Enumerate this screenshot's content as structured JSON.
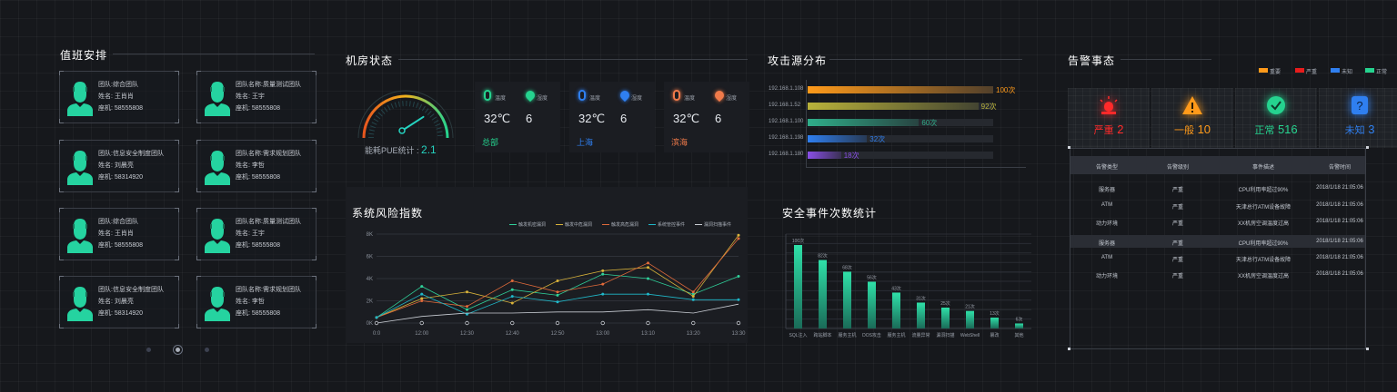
{
  "duty": {
    "title": "值班安排",
    "cards": [
      [
        "团队:综合团队",
        "姓名: 王肖肖",
        "座机: 58555808"
      ],
      [
        "团队名称:质量测试团队",
        "姓名: 王宇",
        "座机: 58555808"
      ],
      [
        "团队:信息安全制度团队",
        "姓名: 刘晨亮",
        "座机: 58314920"
      ],
      [
        "团队名称:需求规划团队",
        "姓名: 李哲",
        "座机: 58555808"
      ],
      [
        "团队:综合团队",
        "姓名: 王肖肖",
        "座机: 58555808"
      ],
      [
        "团队名称:质量测试团队",
        "姓名: 王宇",
        "座机: 58555808"
      ],
      [
        "团队:信息安全制度团队",
        "姓名: 刘晨亮",
        "座机: 58314920"
      ],
      [
        "团队名称:需求规划团队",
        "姓名: 李哲",
        "座机: 58555808"
      ]
    ]
  },
  "room": {
    "title": "机房状态",
    "pue_label": "能耗PUE统计 :",
    "pue_value": "2.1",
    "pue_level": 0.65,
    "sites": [
      {
        "temp_label": "温度",
        "hum_label": "湿度",
        "temp": "32℃",
        "hum": "6",
        "name": "总部",
        "color": "#25d38f"
      },
      {
        "temp_label": "温度",
        "hum_label": "湿度",
        "temp": "32℃",
        "hum": "6",
        "name": "上海",
        "color": "#2f7ff0"
      },
      {
        "temp_label": "温度",
        "hum_label": "湿度",
        "temp": "32℃",
        "hum": "6",
        "name": "滨海",
        "color": "#f07a4a"
      }
    ]
  },
  "attack": {
    "title": "攻击源分布",
    "rows": [
      {
        "ip": "192.168.1.108",
        "value": 100,
        "label": "100次",
        "color": "#ff9a1a"
      },
      {
        "ip": "192.168.1.52",
        "value": 92,
        "label": "92次",
        "color": "#b9b23a"
      },
      {
        "ip": "192.168.1.100",
        "value": 60,
        "label": "60次",
        "color": "#2fae8a"
      },
      {
        "ip": "192.168.1.198",
        "value": 32,
        "label": "32次",
        "color": "#2f7ff0"
      },
      {
        "ip": "192.168.1.180",
        "value": 18,
        "label": "18次",
        "color": "#8a4fe8"
      }
    ]
  },
  "risk": {
    "title": "系统风险指数",
    "chart_data": {
      "type": "line",
      "categories": [
        "0:0",
        "12:00",
        "12:30",
        "12:40",
        "12:50",
        "13:00",
        "13:10",
        "13:20",
        "13:30"
      ],
      "ylim": [
        0,
        8000
      ],
      "yticks": [
        "0K",
        "2K",
        "4K",
        "6K",
        "8K"
      ],
      "series": [
        {
          "name": "触发机密漏洞",
          "color": "#2fd19a",
          "values": [
            500,
            3300,
            1200,
            3000,
            2500,
            4400,
            4000,
            2600,
            4200
          ]
        },
        {
          "name": "触发中危漏洞",
          "color": "#d9b33a",
          "values": [
            500,
            2200,
            2800,
            1800,
            3800,
            4700,
            5000,
            2400,
            7900
          ]
        },
        {
          "name": "触发高危漏洞",
          "color": "#e06a3a",
          "values": [
            500,
            2000,
            1500,
            3800,
            2800,
            3500,
            5400,
            2800,
            7600
          ]
        },
        {
          "name": "系统管控事件",
          "color": "#1fb8c9",
          "values": [
            500,
            2600,
            800,
            2400,
            1900,
            2600,
            2600,
            2100,
            2100
          ]
        },
        {
          "name": "漏洞扫描事件",
          "color": "#c8ccd3",
          "values": [
            0,
            600,
            900,
            900,
            1000,
            1000,
            1200,
            900,
            1700
          ]
        }
      ]
    }
  },
  "events": {
    "title": "安全事件次数统计",
    "chart_data": {
      "type": "bar",
      "categories": [
        "SQL注入",
        "跨站脚本",
        "服务主机",
        "DOS攻击",
        "服务主机",
        "流量异常",
        "漏洞扫描",
        "WebShell",
        "篡改",
        "其他"
      ],
      "values": [
        100,
        82,
        68,
        56,
        43,
        31,
        25,
        21,
        13,
        6
      ],
      "labels": [
        "100次",
        "82次",
        "68次",
        "56次",
        "43次",
        "31次",
        "25次",
        "21次",
        "13次",
        "6次"
      ]
    }
  },
  "alarm": {
    "title": "告警事态",
    "legend": [
      {
        "label": "重要",
        "color": "#ff9a1a"
      },
      {
        "label": "严重",
        "color": "#e81c1c"
      },
      {
        "label": "未知",
        "color": "#2f7ff0"
      },
      {
        "label": "正常",
        "color": "#25d38f"
      }
    ],
    "tiles": [
      {
        "label": "严重",
        "count": "2",
        "color": "#ff2a2a",
        "icon": "siren"
      },
      {
        "label": "一般",
        "count": "10",
        "color": "#ff9a1a",
        "icon": "warning"
      },
      {
        "label": "正常",
        "count": "516",
        "color": "#25d38f",
        "icon": "check"
      },
      {
        "label": "未知",
        "count": "3",
        "color": "#2f7ff0",
        "icon": "question"
      }
    ],
    "table": {
      "headers": [
        "告警类型",
        "告警级别",
        "事件描述",
        "告警时间"
      ],
      "rows": [
        [
          "服务器",
          "严重",
          "CPU利用率超过90%",
          "2018/1/18  21:05:06"
        ],
        [
          "ATM",
          "严重",
          "天津总行ATM设备故障",
          "2018/1/18  21:05:06"
        ],
        [
          "动力环境",
          "严重",
          "XX机房空调温度过高",
          "2018/1/18  21:05:06"
        ],
        [
          "服务器",
          "严重",
          "CPU利用率超过90%",
          "2018/1/18  21:05:06"
        ],
        [
          "ATM",
          "严重",
          "天津总行ATM设备故障",
          "2018/1/18  21:05:06"
        ],
        [
          "动力环境",
          "严重",
          "XX机房空调温度过高",
          "2018/1/18  21:05:06"
        ]
      ]
    }
  }
}
